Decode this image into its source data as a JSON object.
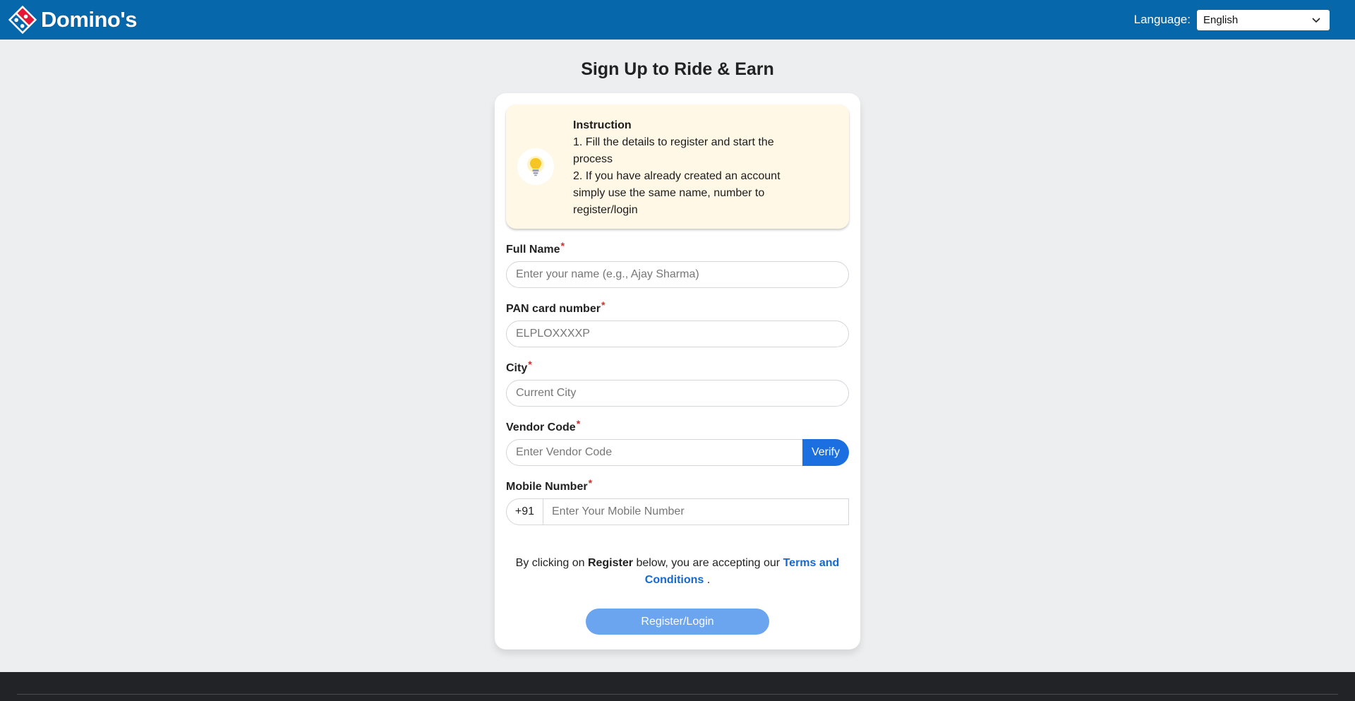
{
  "header": {
    "brand_name": "Domino's",
    "language_label": "Language:",
    "language_selected": "English"
  },
  "page": {
    "title": "Sign Up to Ride & Earn"
  },
  "instruction": {
    "title": "Instruction",
    "line1": "1. Fill the details to register and start the process",
    "line2": "2. If you have already created an account simply use the same name, number to register/login"
  },
  "form": {
    "full_name": {
      "label": "Full Name",
      "placeholder": "Enter your name (e.g., Ajay Sharma)"
    },
    "pan": {
      "label": "PAN card number",
      "placeholder": "ELPLOXXXXP"
    },
    "city": {
      "label": "City",
      "placeholder": "Current City"
    },
    "vendor": {
      "label": "Vendor Code",
      "placeholder": "Enter Vendor Code",
      "verify_label": "Verify"
    },
    "mobile": {
      "label": "Mobile Number",
      "country_code": "+91",
      "placeholder": "Enter Your Mobile Number"
    },
    "required_mark": "*"
  },
  "terms": {
    "prefix": "By clicking on",
    "bold_word": "Register",
    "middle": "below, you are accepting our",
    "link_text": "Terms and Conditions",
    "suffix": "."
  },
  "actions": {
    "register_label": "Register/Login"
  },
  "colors": {
    "header_bg": "#0767ab",
    "primary_button": "#1c6fe0",
    "register_button": "#6ba4ef",
    "instruction_bg": "#fff8e6",
    "link": "#1568cf",
    "required": "#e0262e"
  }
}
